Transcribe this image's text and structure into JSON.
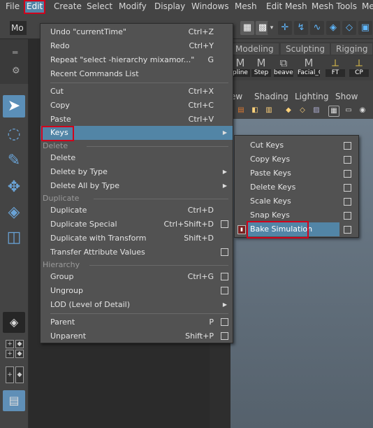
{
  "menubar": {
    "items": [
      "File",
      "Edit",
      "Create",
      "Select",
      "Modify",
      "Display",
      "Windows",
      "Mesh",
      "Edit Mesh",
      "Mesh Tools",
      "Me"
    ]
  },
  "toolbar": {
    "mode": "Mo"
  },
  "shelf": {
    "tabs": [
      "Modeling",
      "Sculpting",
      "Rigging"
    ],
    "icons": [
      "pline",
      "Step",
      "beaver",
      "Facial_C",
      "FT",
      "CP"
    ]
  },
  "panel": {
    "menu": [
      "ew",
      "Shading",
      "Lighting",
      "Show"
    ]
  },
  "edit_menu": {
    "items": {
      "undo": {
        "label": "Undo \"currentTime\"",
        "shortcut": "Ctrl+Z"
      },
      "redo": {
        "label": "Redo",
        "shortcut": "Ctrl+Y"
      },
      "repeat": {
        "label": "Repeat \"select -hierarchy mixamor...\"",
        "shortcut": "G"
      },
      "recent": {
        "label": "Recent Commands List"
      },
      "cut": {
        "label": "Cut",
        "shortcut": "Ctrl+X"
      },
      "copy": {
        "label": "Copy",
        "shortcut": "Ctrl+C"
      },
      "paste": {
        "label": "Paste",
        "shortcut": "Ctrl+V"
      },
      "keys": {
        "label": "Keys"
      },
      "delete": {
        "label": "Delete"
      },
      "delete_by_type": {
        "label": "Delete by Type"
      },
      "delete_all_by_type": {
        "label": "Delete All by Type"
      },
      "duplicate": {
        "label": "Duplicate",
        "shortcut": "Ctrl+D"
      },
      "duplicate_special": {
        "label": "Duplicate Special",
        "shortcut": "Ctrl+Shift+D"
      },
      "duplicate_transform": {
        "label": "Duplicate with Transform",
        "shortcut": "Shift+D"
      },
      "transfer": {
        "label": "Transfer Attribute Values"
      },
      "group": {
        "label": "Group",
        "shortcut": "Ctrl+G"
      },
      "ungroup": {
        "label": "Ungroup"
      },
      "lod": {
        "label": "LOD (Level of Detail)"
      },
      "parent": {
        "label": "Parent",
        "shortcut": "P"
      },
      "unparent": {
        "label": "Unparent",
        "shortcut": "Shift+P"
      }
    },
    "sections": {
      "delete": "Delete",
      "duplicate": "Duplicate",
      "hierarchy": "Hierarchy"
    }
  },
  "keys_menu": {
    "items": [
      "Cut Keys",
      "Copy Keys",
      "Paste Keys",
      "Delete Keys",
      "Scale Keys",
      "Snap Keys",
      "Bake Simulation"
    ]
  },
  "colors": {
    "highlight": "#5285a6",
    "annotation": "#d0021b",
    "menu_bg": "#525252"
  }
}
